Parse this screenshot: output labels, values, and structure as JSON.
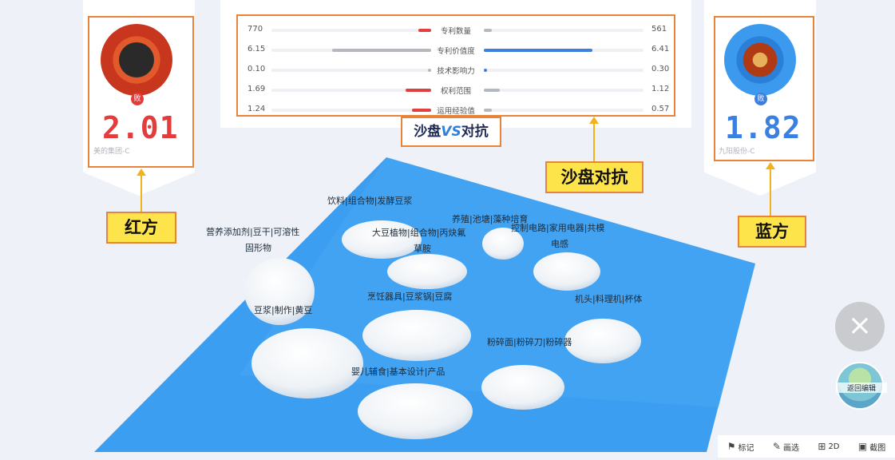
{
  "red_player": {
    "badge": "败",
    "score": "2.01",
    "company": "美的集团-C",
    "callout": "红方",
    "color": "#e23c3c"
  },
  "blue_player": {
    "badge": "败",
    "score": "1.82",
    "company": "九阳股份-C",
    "callout": "蓝方",
    "color": "#3b7fe0"
  },
  "comparison": {
    "metrics": [
      {
        "name": "专利数量",
        "left": "770",
        "right": "561",
        "left_fill": 0.08,
        "right_fill": 0.05,
        "left_color": "#e2403f",
        "right_color": "#b5b8be"
      },
      {
        "name": "专利价值度",
        "left": "6.15",
        "right": "6.41",
        "left_fill": 0.62,
        "right_fill": 0.68,
        "left_color": "#b5b8be",
        "right_color": "#3b7fe0"
      },
      {
        "name": "技术影响力",
        "left": "0.10",
        "right": "0.30",
        "left_fill": 0.02,
        "right_fill": 0.02,
        "left_color": "#b5b8be",
        "right_color": "#3b7fe0"
      },
      {
        "name": "权利范围",
        "left": "1.69",
        "right": "1.12",
        "left_fill": 0.16,
        "right_fill": 0.1,
        "left_color": "#e2403f",
        "right_color": "#b5b8be"
      },
      {
        "name": "运用经验值",
        "left": "1.24",
        "right": "0.57",
        "left_fill": 0.12,
        "right_fill": 0.05,
        "left_color": "#e2403f",
        "right_color": "#b5b8be"
      }
    ]
  },
  "logo": {
    "part1": "沙盘",
    "vs": "VS",
    "part2": "对抗"
  },
  "sandbox_callout": "沙盘对抗",
  "map_labels": [
    "饮料|组合物|发酵豆浆",
    "营养添加剂|豆干|可溶性",
    "固形物",
    "大豆植物|组合物|丙炔氟",
    "草胺",
    "养殖|池塘|藻种培育",
    "控制电路|家用电器|共模",
    "电感",
    "烹饪器具|豆浆锅|豆腐",
    "豆浆|制作|黄豆",
    "机头|料理机|杯体",
    "粉碎面|粉碎刀|粉碎器",
    "婴儿辅食|基本设计|产品"
  ],
  "buttons": {
    "close": "×",
    "back": "返回编辑"
  },
  "toolbar": [
    {
      "icon": "flag-icon",
      "glyph": "⚑",
      "label": "标记"
    },
    {
      "icon": "pencil-icon",
      "glyph": "✎",
      "label": "画选"
    },
    {
      "icon": "grid-icon",
      "glyph": "⊞",
      "label": "2D"
    },
    {
      "icon": "image-icon",
      "glyph": "▣",
      "label": "截图"
    }
  ],
  "colors": {
    "highlight": "#e8843a",
    "callout_bg": "#fde44a",
    "water": "#3c9ef0"
  }
}
